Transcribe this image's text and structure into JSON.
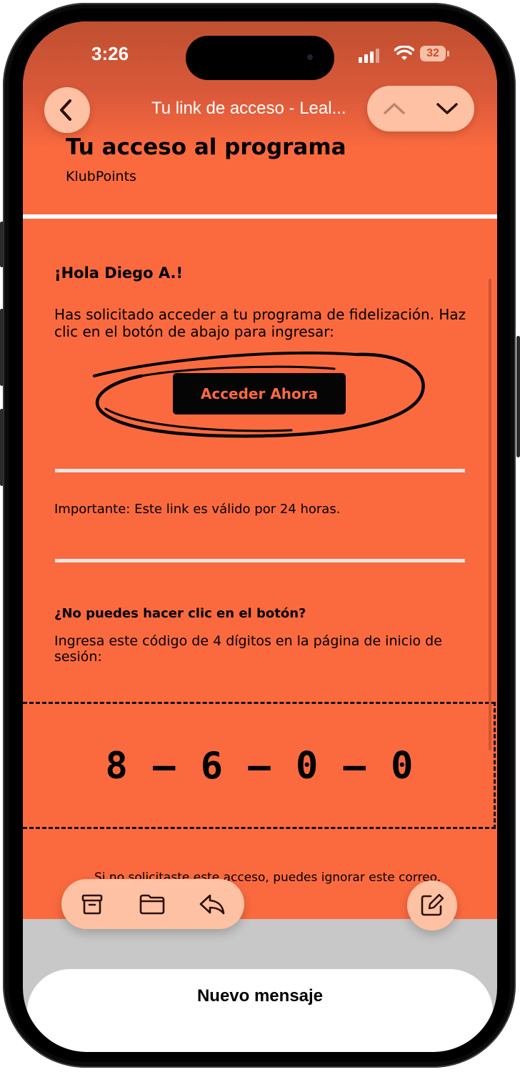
{
  "status_bar": {
    "time": "3:26",
    "battery": "32"
  },
  "nav": {
    "title": "Tu link de acceso - Leal...",
    "back_icon": "chevron-left-icon",
    "prev_icon": "chevron-up-icon",
    "next_icon": "chevron-down-icon"
  },
  "email": {
    "title": "Tu acceso al programa",
    "sender": "KlubPoints",
    "greeting": "¡Hola Diego A.!",
    "body": "Has solicitado acceder a tu programa de fidelización. Haz clic en el botón de abajo para ingresar:",
    "button_label": "Acceder Ahora",
    "important_note": "Importante: Este link es válido por 24 horas.",
    "fallback_title": "¿No puedes hacer clic en el botón?",
    "fallback_text": "Ingresa este código de 4 dígitos en la página de inicio de sesión:",
    "code": "8 – 6 – 0 – 0",
    "footer_note": "Si no solicitaste este acceso, puedes ignorar este correo."
  },
  "toolbar": {
    "archive_icon": "archive-icon",
    "folder_icon": "folder-icon",
    "reply_icon": "reply-icon",
    "compose_icon": "compose-icon"
  },
  "bottom_sheet": {
    "label": "Nuevo mensaje"
  },
  "colors": {
    "email_background": "#fb6a3f",
    "button_background": "#050505",
    "pill_background": "#ffc1a3"
  }
}
